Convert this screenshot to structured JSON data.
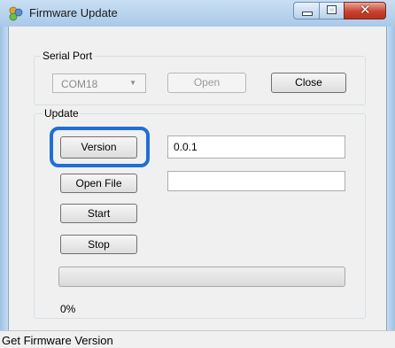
{
  "window": {
    "title": "Firmware Update",
    "app_icon": "puzzle-app-icon",
    "caption_buttons": [
      "minimize",
      "maximize",
      "close"
    ]
  },
  "serial_port": {
    "label": "Serial Port",
    "port_value": "COM18",
    "open_label": "Open",
    "close_label": "Close"
  },
  "update": {
    "label": "Update",
    "version_label": "Version",
    "version_value": "0.0.1",
    "open_file_label": "Open File",
    "file_value": "",
    "start_label": "Start",
    "stop_label": "Stop",
    "progress": 0,
    "percent_text": "0%"
  },
  "status": {
    "text": "Get Firmware Version"
  },
  "colors": {
    "highlight": "#1f6fd6"
  }
}
